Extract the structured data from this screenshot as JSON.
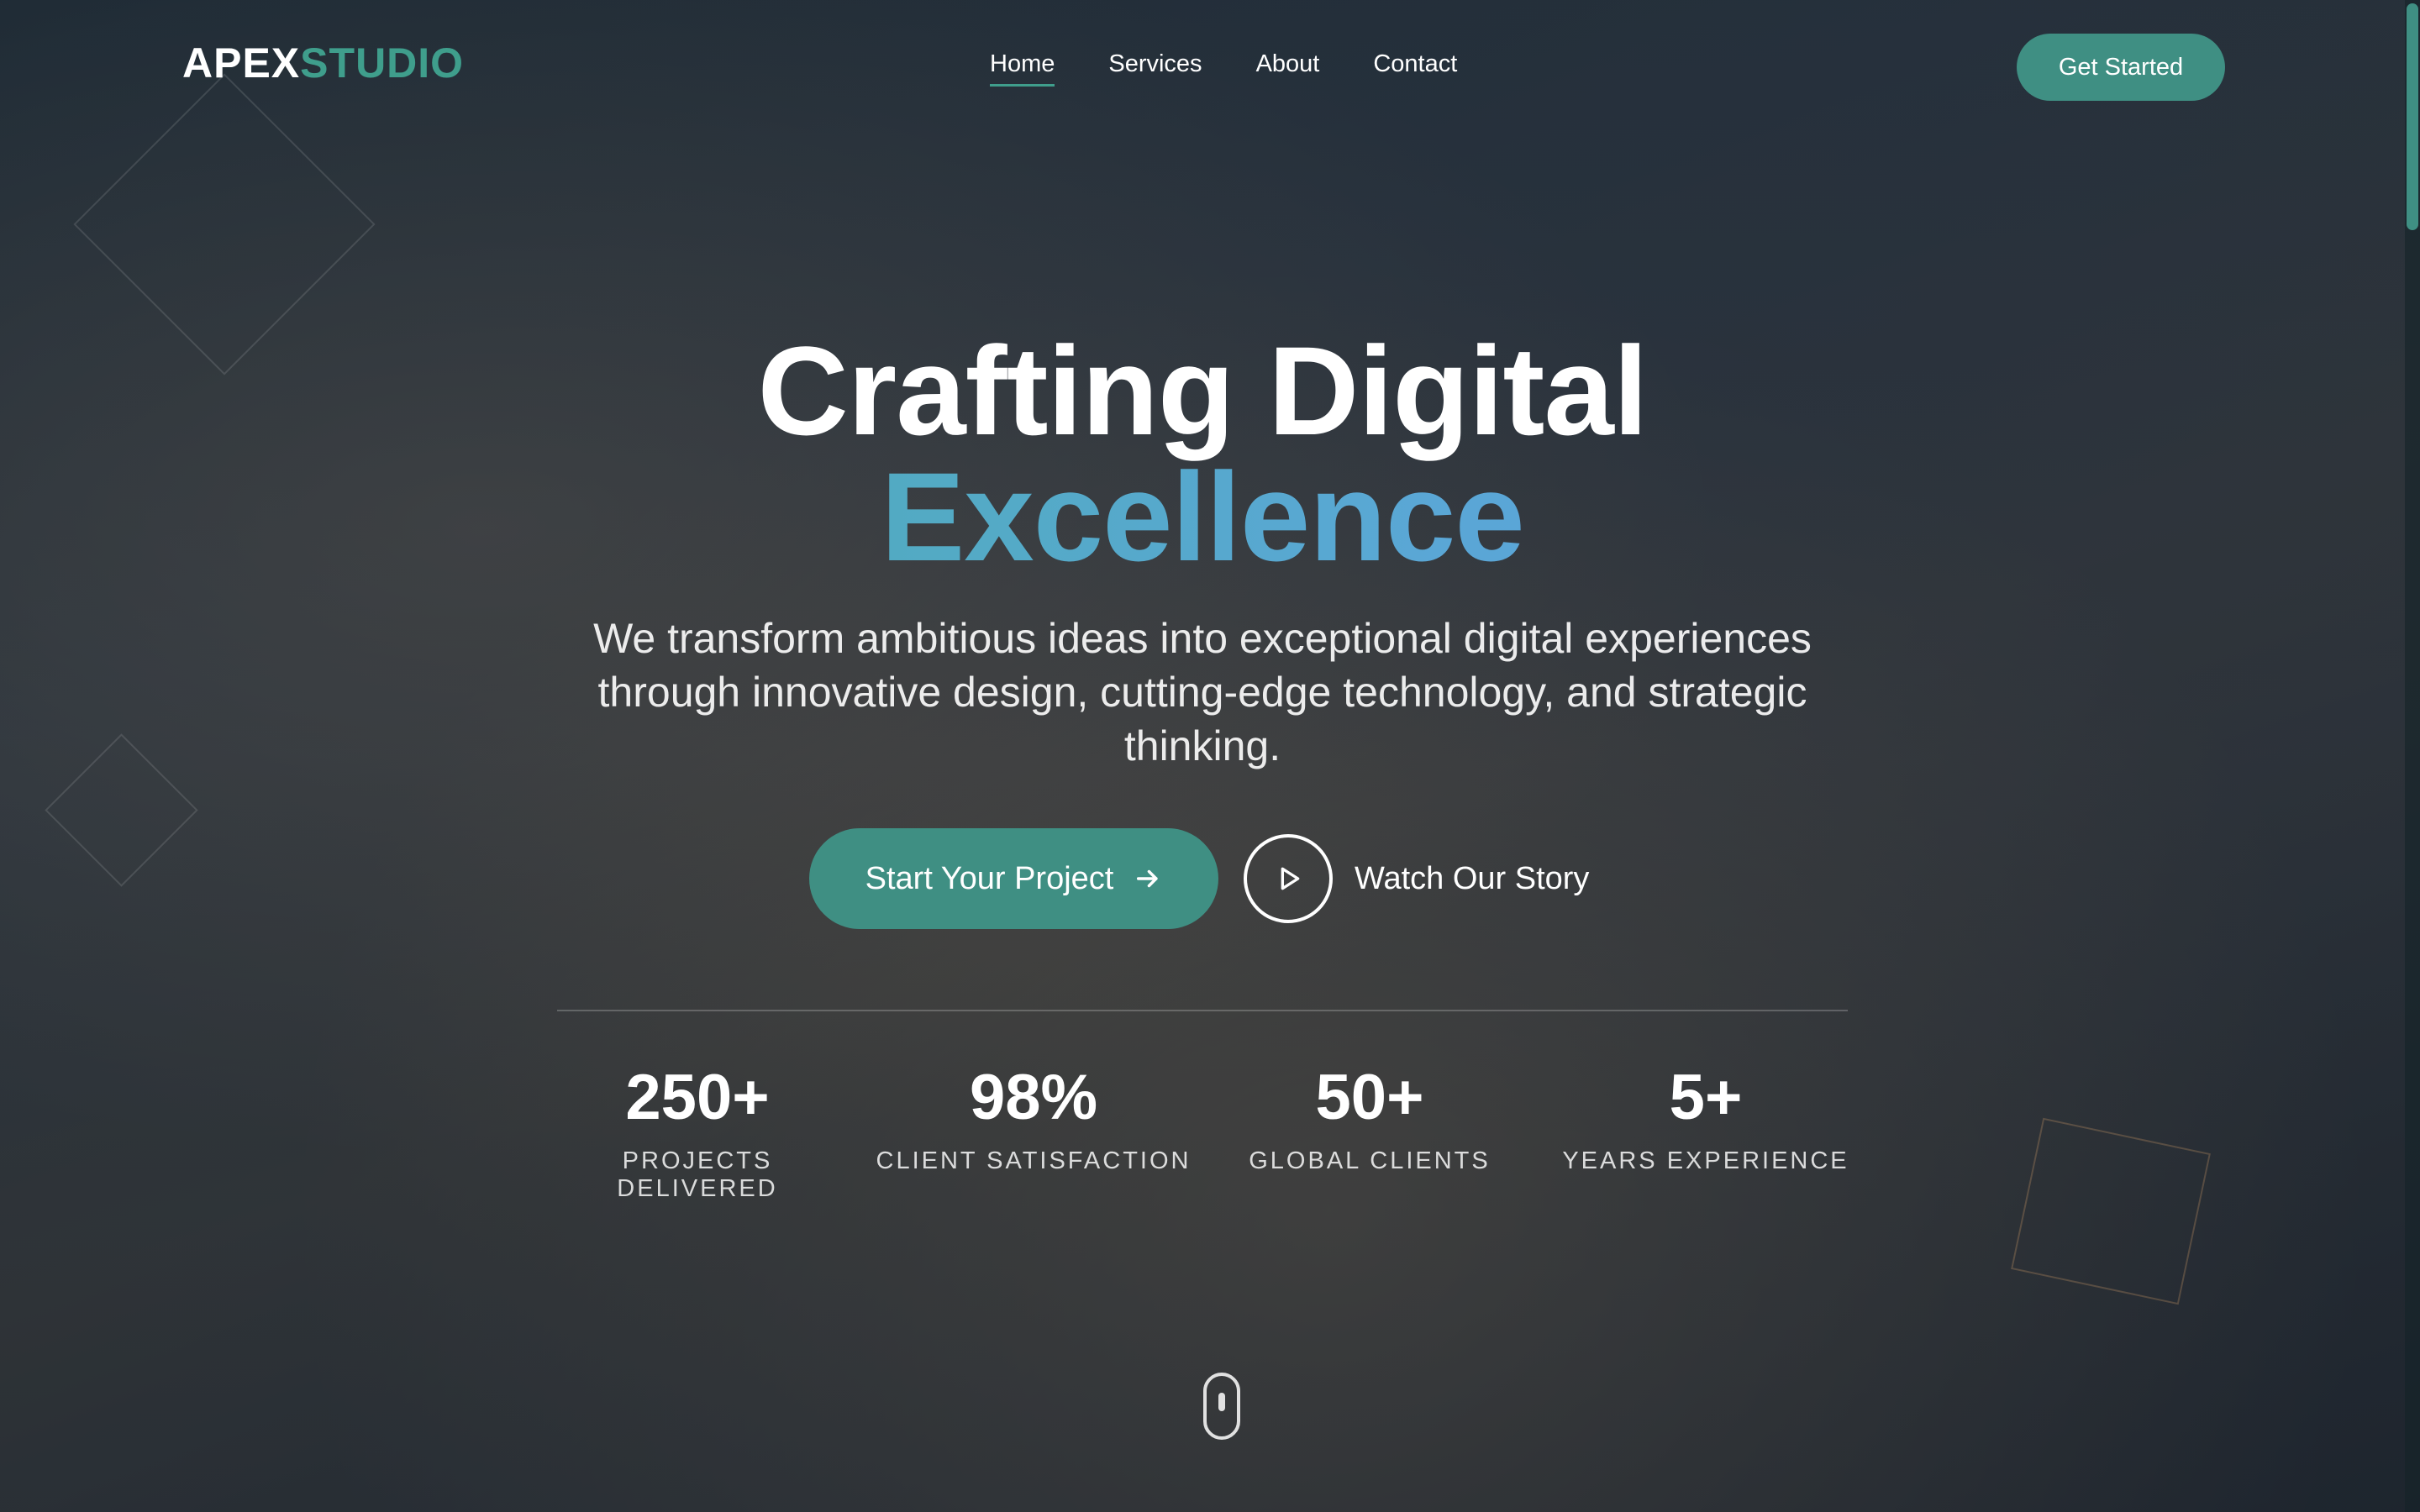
{
  "nav": {
    "logo_primary": "APEX",
    "logo_accent": "STUDIO",
    "items": [
      {
        "label": "Home",
        "active": true
      },
      {
        "label": "Services",
        "active": false
      },
      {
        "label": "About",
        "active": false
      },
      {
        "label": "Contact",
        "active": false
      }
    ],
    "cta_label": "Get Started"
  },
  "hero": {
    "headline_line1": "Crafting Digital",
    "headline_line2": "Excellence",
    "subtitle": "We transform ambitious ideas into exceptional digital experiences through innovative design, cutting-edge technology, and strategic thinking.",
    "primary_button_label": "Start Your Project",
    "primary_button_icon": "arrow-right-icon",
    "secondary_button_label": "Watch Our Story",
    "secondary_button_icon": "play-icon"
  },
  "stats": [
    {
      "value": "250+",
      "label": "PROJECTS DELIVERED"
    },
    {
      "value": "98%",
      "label": "CLIENT SATISFACTION"
    },
    {
      "value": "50+",
      "label": "GLOBAL CLIENTS"
    },
    {
      "value": "5+",
      "label": "YEARS EXPERIENCE"
    }
  ],
  "scroll_indicator_icon": "mouse-scroll-icon",
  "colors": {
    "accent": "#3f8f83",
    "gradient_start": "#46b0a4",
    "gradient_end": "#5b93e0"
  }
}
